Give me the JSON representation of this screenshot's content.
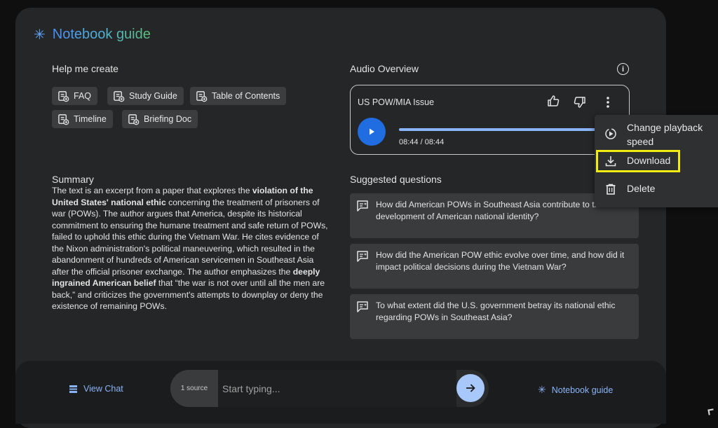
{
  "header": {
    "title": "Notebook guide",
    "icon": "sparkle-icon"
  },
  "help": {
    "heading": "Help me create",
    "chips": [
      {
        "label": "FAQ"
      },
      {
        "label": "Study Guide"
      },
      {
        "label": "Table of Contents"
      },
      {
        "label": "Timeline"
      },
      {
        "label": "Briefing Doc"
      }
    ]
  },
  "summary": {
    "heading": "Summary",
    "parts": [
      "The text is an excerpt from a paper that explores the ",
      "violation of the United States' national ethic",
      " concerning the treatment of prisoners of war (POWs). The author argues that America, despite its historical commitment to ensuring the humane treatment and safe return of POWs, failed to uphold this ethic during the Vietnam War. He cites evidence of the Nixon administration's political maneuvering, which resulted in the abandonment of hundreds of American servicemen in Southeast Asia after the official prisoner exchange. The author emphasizes the ",
      "deeply ingrained American belief",
      " that “the war is not over until all the men are back,” and criticizes the government's attempts to downplay or deny the existence of remaining POWs."
    ]
  },
  "audio": {
    "heading": "Audio Overview",
    "title": "US POW/MIA Issue",
    "time": "08:44 / 08:44",
    "progress": 1.0
  },
  "menu": {
    "items": [
      {
        "label": "Change playback speed",
        "icon": "playback-speed-icon"
      },
      {
        "label": "Download",
        "icon": "download-icon"
      },
      {
        "label": "Delete",
        "icon": "trash-icon"
      }
    ]
  },
  "suggested": {
    "heading": "Suggested questions",
    "questions": [
      "How did American POWs in Southeast Asia contribute to the development of American national identity?",
      "How did the American POW ethic evolve over time, and how did it impact political decisions during the Vietnam War?",
      "To what extent did the U.S. government betray its national ethic regarding POWs in Southeast Asia?"
    ]
  },
  "bottom": {
    "view_chat": "View Chat",
    "source_count": "1 source",
    "input_placeholder": "Start typing...",
    "notebook_guide": "Notebook guide"
  },
  "colors": {
    "accent": "#8ab4f8",
    "play": "#1f6de0",
    "highlight": "#f3ec12"
  }
}
